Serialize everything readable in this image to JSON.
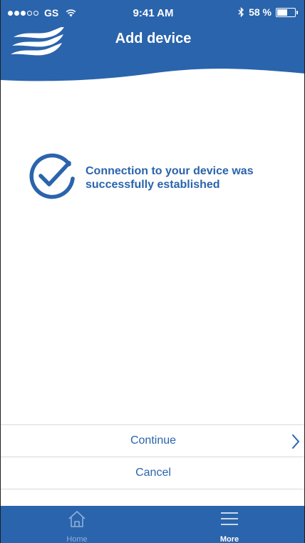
{
  "status_bar": {
    "carrier": "GS",
    "time": "9:41 AM",
    "battery_percent": "58 %",
    "signal_bars_filled": 3,
    "signal_bars_total": 5
  },
  "header": {
    "title": "Add device"
  },
  "content": {
    "message": "Connection to your device was successfully established"
  },
  "actions": {
    "continue_label": "Continue",
    "cancel_label": "Cancel"
  },
  "tab_bar": {
    "tabs": [
      {
        "label": "Home",
        "icon": "home-icon",
        "active": false
      },
      {
        "label": "More",
        "icon": "menu-icon",
        "active": true
      }
    ]
  },
  "colors": {
    "brand_blue": "#2a64ac",
    "inactive_tab": "#8fb0d8",
    "divider": "#d9d9d9"
  }
}
